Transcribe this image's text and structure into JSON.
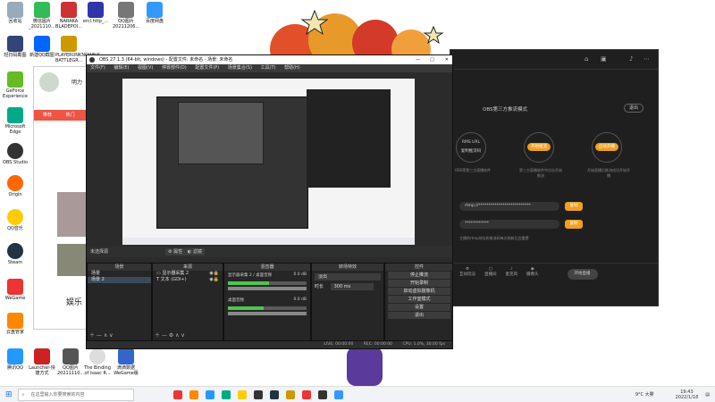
{
  "desktop_icons": [
    {
      "label": "回收站",
      "color": "#9ab"
    },
    {
      "label": "微信图片_2021110...",
      "color": "#3b5"
    },
    {
      "label": "NARAKA BLADEPOI...",
      "color": "#c33"
    },
    {
      "label": "ercl.http_...",
      "color": "#33a"
    },
    {
      "label": "QQ图片20211206...",
      "color": "#777"
    },
    {
      "label": "百度网盘",
      "color": "#39f"
    },
    {
      "label": "轻扫码截图",
      "color": "#347"
    },
    {
      "label": "新建QQ截图",
      "color": "#06f"
    },
    {
      "label": "PLAYERUNKNOWN'S BATTLEGR...",
      "color": "#c90"
    },
    {
      "label": "GeForce Experience",
      "color": "#6b2"
    },
    {
      "label": "Microsoft Edge",
      "color": "#0a8"
    },
    {
      "label": "OBS Studio",
      "color": "#333"
    },
    {
      "label": "Origin",
      "color": "#f60"
    },
    {
      "label": "QQ音乐",
      "color": "#fc0"
    },
    {
      "label": "Steam",
      "color": "#234"
    },
    {
      "label": "WeGame",
      "color": "#e33"
    },
    {
      "label": "云盘管家",
      "color": "#f80"
    },
    {
      "label": "腾讯QQ",
      "color": "#29f"
    },
    {
      "label": "Launcher-快捷方式",
      "color": "#c22"
    },
    {
      "label": "QQ图片20211110...",
      "color": "#555"
    },
    {
      "label": "The Binding of Isaac R...",
      "color": "#ddd"
    },
    {
      "label": "滴滴数据WeGame版",
      "color": "#36c"
    }
  ],
  "obs": {
    "title": "OBS 27.1.3 (64-bit, windows) - 配置文件: 未命名 - 场景: 未命名",
    "menu": [
      "文件(F)",
      "编辑(E)",
      "视图(V)",
      "停靠部件(D)",
      "配置文件(P)",
      "场景集合(S)",
      "工具(T)",
      "帮助(H)"
    ],
    "source_toolbar": {
      "label": "未选择源",
      "properties": "属性",
      "filters": "滤镜"
    },
    "scenes": {
      "title": "场景",
      "items": [
        "场景",
        "场景 2"
      ]
    },
    "sources": {
      "title": "来源",
      "items": [
        "显示器采集 2",
        "文本 (GDI+)"
      ]
    },
    "mixer": {
      "title": "混音器",
      "channels": [
        {
          "name": "显示器采集 2 / 桌面音频",
          "db": "0.0 dB",
          "level": 0.52
        },
        {
          "name": "桌面音频",
          "db": "0.0 dB",
          "level": 0.46
        }
      ]
    },
    "transitions": {
      "title": "转场特效",
      "value": "淡出",
      "duration_label": "时长",
      "duration": "300 ms"
    },
    "controls": {
      "title": "控件",
      "buttons": [
        "停止推流",
        "开始录制",
        "启动虚拟摄像机",
        "工作室模式",
        "设置",
        "退出"
      ]
    },
    "status": {
      "live": "LIVE: 00:00:00",
      "rec": "REC: 00:00:00",
      "cpu": "CPU: 1.0%, 30.00 fps"
    }
  },
  "live_panel": {
    "mode_label": "OBS第三方推流模式",
    "switch_button": "退出",
    "steps": [
      {
        "num": "1",
        "title": "RMS URL",
        "desc": "复制推流码",
        "sub": "OBS等第三方直播软件"
      },
      {
        "num": "2",
        "title": "开始推流",
        "desc": "第三方直播软件中点击开始推流"
      },
      {
        "num": "3",
        "title": "启动开播",
        "desc": "开始直播后推流成功开始开播"
      }
    ],
    "server_field": "rtmp://**************************",
    "key_field": "************",
    "copy_button": "复制",
    "hint": "主播的rtmp地址和推流码每次刷新后会重置",
    "bottom_tools": [
      "互动玩法",
      "直播间",
      "麦克风",
      "摄像头",
      "关注"
    ],
    "start_button": "开始直播"
  },
  "wechat": {
    "name": "明力",
    "tabs": [
      "推荐",
      "热门"
    ],
    "footer": "娱乐"
  },
  "taskbar": {
    "search_placeholder": "在这里输入你要搜索的内容",
    "weather": "9°C 大雾",
    "time": "19:43",
    "date": "2022/1/18",
    "apps": [
      "#e33",
      "#f80",
      "#29f",
      "#0a8",
      "#fc0",
      "#333",
      "#234",
      "#c90",
      "#e33",
      "#333",
      "#39f"
    ]
  }
}
